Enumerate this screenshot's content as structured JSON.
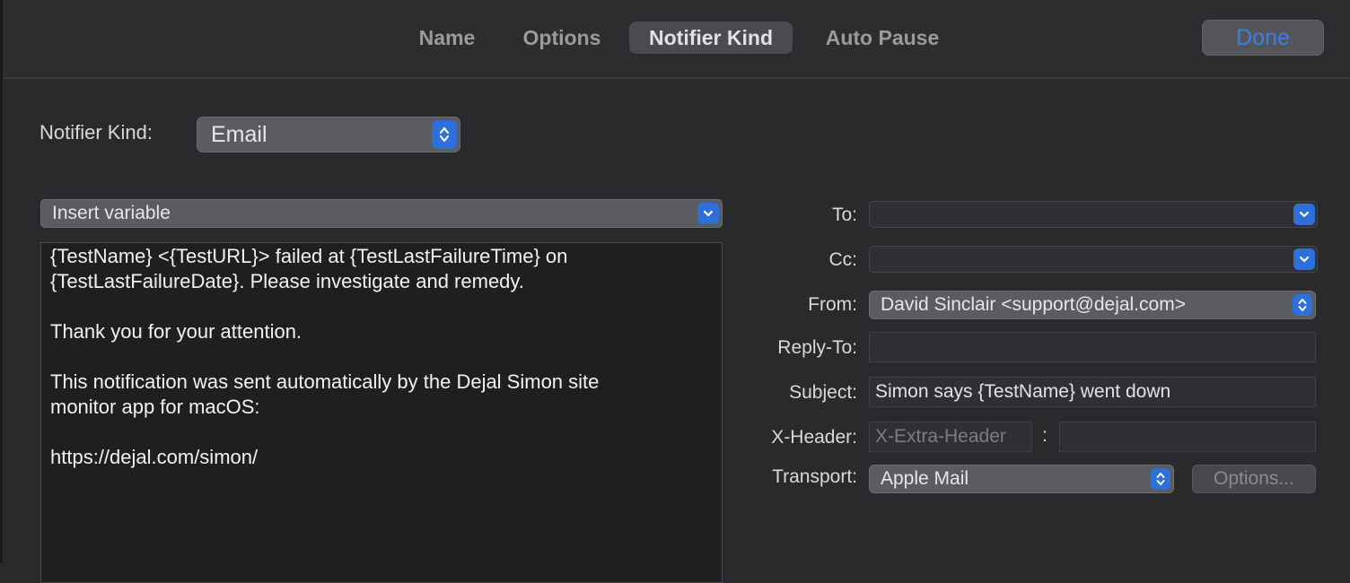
{
  "tabs": [
    {
      "label": "Name",
      "selected": false
    },
    {
      "label": "Options",
      "selected": false
    },
    {
      "label": "Notifier Kind",
      "selected": true
    },
    {
      "label": "Auto Pause",
      "selected": false
    }
  ],
  "done_label": "Done",
  "notifier_kind": {
    "label": "Notifier Kind:",
    "value": "Email"
  },
  "insert_variable_label": "Insert variable",
  "message_body": {
    "lines": [
      "{TestName} <{TestURL}> failed at {TestLastFailureTime} on",
      "{TestLastFailureDate}.  Please investigate and remedy.",
      "",
      "Thank you for your attention.",
      "",
      "This notification was sent automatically by the Dejal Simon site",
      "monitor app for macOS:",
      "",
      "https://dejal.com/simon/"
    ]
  },
  "form": {
    "to_label": "To:",
    "to_value": "",
    "cc_label": "Cc:",
    "cc_value": "",
    "from_label": "From:",
    "from_value": "David Sinclair <support@dejal.com>",
    "reply_to_label": "Reply-To:",
    "reply_to_value": "",
    "subject_label": "Subject:",
    "subject_value": "Simon says {TestName} went down",
    "x_header_label": "X-Header:",
    "x_header_name_placeholder": "X-Extra-Header",
    "x_header_separator": ":",
    "x_header_value": "",
    "transport_label": "Transport:",
    "transport_value": "Apple Mail",
    "options_label": "Options..."
  },
  "colors": {
    "accent": "#2f6fd8",
    "done_text": "#3d7fe0",
    "background": "#292a2c"
  }
}
